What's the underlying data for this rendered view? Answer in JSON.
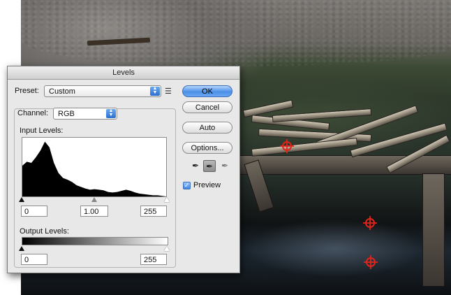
{
  "dialog": {
    "title": "Levels",
    "preset_label": "Preset:",
    "preset_value": "Custom",
    "channel_label": "Channel:",
    "channel_value": "RGB",
    "input_levels_label": "Input Levels:",
    "input_black": "0",
    "input_gamma": "1.00",
    "input_white": "255",
    "output_levels_label": "Output Levels:",
    "output_black": "0",
    "output_white": "255",
    "buttons": {
      "ok": "OK",
      "cancel": "Cancel",
      "auto": "Auto",
      "options": "Options..."
    },
    "preview_label": "Preview",
    "preview_checked": true,
    "selected_dropper": "gray",
    "icons": {
      "preset_menu": "preset-options-icon",
      "black_dropper": "black-eyedropper-icon",
      "gray_dropper": "gray-eyedropper-icon",
      "white_dropper": "white-eyedropper-icon"
    },
    "colors": {
      "default_button": "#4a8fe6",
      "sampler_marker": "#e2231a"
    }
  },
  "histogram": {
    "channel": "RGB",
    "levels_sampled": [
      0,
      8,
      16,
      24,
      32,
      40,
      48,
      56,
      64,
      72,
      80,
      88,
      96,
      104,
      112,
      120,
      128,
      136,
      144,
      152,
      160,
      168,
      176,
      184,
      192,
      200,
      208,
      216,
      224,
      232,
      240,
      248,
      255
    ],
    "relative_counts": [
      0.55,
      0.62,
      0.6,
      0.7,
      0.82,
      0.98,
      0.88,
      0.6,
      0.42,
      0.33,
      0.3,
      0.26,
      0.2,
      0.17,
      0.14,
      0.12,
      0.13,
      0.12,
      0.11,
      0.08,
      0.07,
      0.08,
      0.1,
      0.12,
      0.1,
      0.07,
      0.05,
      0.04,
      0.03,
      0.02,
      0.02,
      0.01,
      0.0
    ]
  }
}
